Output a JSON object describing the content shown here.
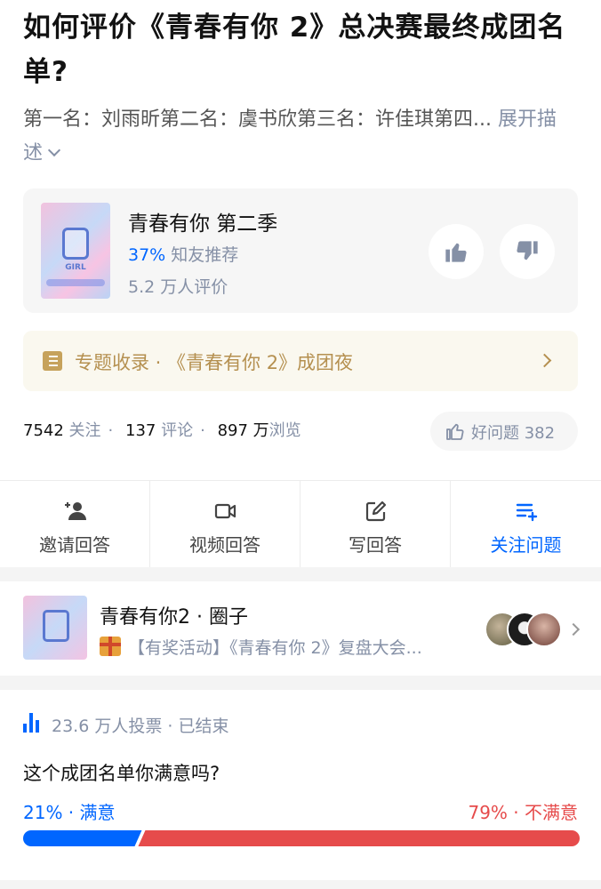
{
  "question": {
    "title": "如何评价《青春有你 2》总决赛最终成团名单?",
    "description": "第一名：刘雨昕第二名：虞书欣第三名：许佳琪第四...",
    "expand_label": "展开描述"
  },
  "show_card": {
    "name": "青春有你 第二季",
    "recommend_pct": "37%",
    "recommend_label": "知友推荐",
    "rating_count": "5.2 万人评价",
    "poster_text": "GIRL"
  },
  "topic": {
    "label": "专题收录 · 《青春有你 2》成团夜"
  },
  "stats": {
    "followers": "7542",
    "followers_label": "关注",
    "comments": "137",
    "comments_label": "评论",
    "views": "897 万",
    "views_label": "浏览",
    "good_question_label": "好问题 382"
  },
  "actions": [
    {
      "label": "邀请回答",
      "icon": "invite-icon"
    },
    {
      "label": "视频回答",
      "icon": "video-icon"
    },
    {
      "label": "写回答",
      "icon": "edit-icon"
    },
    {
      "label": "关注问题",
      "icon": "follow-list-icon"
    }
  ],
  "circle": {
    "name": "青春有你2 · 圈子",
    "activity": "【有奖活动】《青春有你 2》复盘大会..."
  },
  "poll": {
    "meta": "23.6 万人投票 · 已结束",
    "question": "这个成团名单你满意吗?",
    "option_left": "21% · 满意",
    "option_right": "79% · 不满意",
    "left_fraction": 0.21,
    "right_fraction": 0.79,
    "left_color": "#0066ff",
    "right_color": "#e64b4b"
  },
  "colors": {
    "accent": "#0066ff",
    "topic_gold": "#b59050",
    "negative": "#e64b4b"
  }
}
